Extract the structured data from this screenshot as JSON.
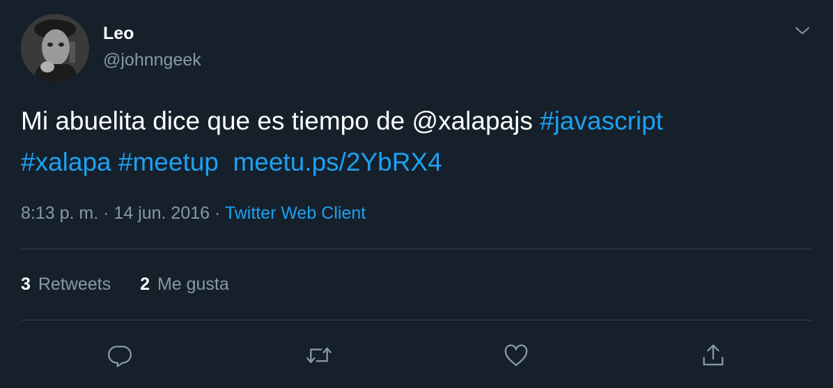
{
  "author": {
    "display_name": "Leo",
    "handle": "@johnngeek"
  },
  "tweet": {
    "text_plain": "Mi abuelita dice que es tiempo de ",
    "mention": "@xalapajs",
    "hashtag1": "#javascript",
    "hashtag2": "#xalapa",
    "hashtag3": "#meetup",
    "link": "meetu.ps/2YbRX4"
  },
  "meta": {
    "time": "8:13 p. m.",
    "sep1": "·",
    "date": "14 jun. 2016",
    "sep2": "·",
    "client": "Twitter Web Client"
  },
  "stats": {
    "retweets_count": "3",
    "retweets_label": "Retweets",
    "likes_count": "2",
    "likes_label": "Me gusta"
  },
  "colors": {
    "background": "#15202b",
    "accent": "#1da1f2",
    "secondary_text": "#8899a6",
    "divider": "#38444d"
  },
  "icons": {
    "caret": "chevron-down-icon",
    "reply": "reply-icon",
    "retweet": "retweet-icon",
    "like": "heart-icon",
    "share": "share-icon"
  }
}
